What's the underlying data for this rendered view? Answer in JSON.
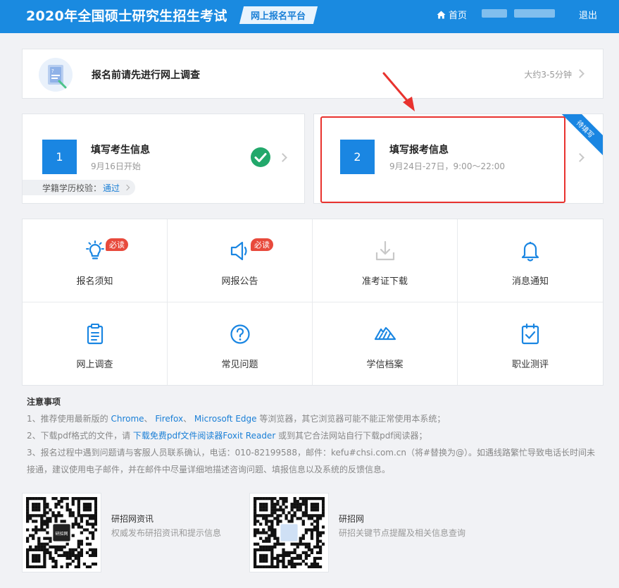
{
  "header": {
    "title": "2020年全国硕士研究生招生考试",
    "platform_tag": "网上报名平台",
    "home_label": "首页",
    "logout_label": "退出"
  },
  "survey": {
    "text": "报名前请先进行网上调查",
    "time": "大约3-5分钟"
  },
  "steps": [
    {
      "number": "1",
      "title": "填写考生信息",
      "sub": "9月16日开始",
      "verify_label": "学籍学历校验：",
      "verify_status": "通过"
    },
    {
      "number": "2",
      "title": "填写报考信息",
      "sub": "9月24日-27日，9:00～22:00",
      "ribbon": "待填写"
    }
  ],
  "grid": {
    "items": [
      {
        "label": "报名须知",
        "icon": "bulb-icon",
        "badge": "必读"
      },
      {
        "label": "网报公告",
        "icon": "megaphone-icon",
        "badge": "必读"
      },
      {
        "label": "准考证下载",
        "icon": "download-icon"
      },
      {
        "label": "消息通知",
        "icon": "bell-icon"
      },
      {
        "label": "网上调查",
        "icon": "clipboard-icon"
      },
      {
        "label": "常见问题",
        "icon": "question-icon"
      },
      {
        "label": "学信档案",
        "icon": "archive-icon"
      },
      {
        "label": "职业测评",
        "icon": "evaluation-icon"
      }
    ]
  },
  "notes": {
    "title": "注意事项",
    "line1_pre": "1、推荐使用最新版的 ",
    "browser1": "Chrome",
    "sep1": "、 ",
    "browser2": "Firefox",
    "sep2": "、 ",
    "browser3": "Microsoft Edge",
    "line1_post": " 等浏览器，其它浏览器可能不能正常使用本系统；",
    "line2_pre": "2、下载pdf格式的文件，请 ",
    "line2_link": "下载免费pdf文件阅读器Foxit Reader",
    "line2_post": " 或到其它合法网站自行下载pdf阅读器；",
    "line3": "3、报名过程中遇到问题请与客服人员联系确认，电话：010-82199588，邮件：kefu#chsi.com.cn（将#替换为@）。如遇线路繁忙导致电话长时间未接通，建议使用电子邮件，并在邮件中尽量详细地描述咨询问题、填报信息以及系统的反馈信息。"
  },
  "qr": [
    {
      "name": "研招网资讯",
      "desc": "权威发布研招资讯和提示信息",
      "center_text": "研招网"
    },
    {
      "name": "研招网",
      "desc": "研招关键节点提醒及相关信息查询"
    }
  ],
  "colors": {
    "header_bg": "#1a8ae0",
    "accent": "#1a86e2",
    "badge_red": "#e84a3c",
    "highlight_red": "#e8322e",
    "check_green": "#22a86b"
  }
}
